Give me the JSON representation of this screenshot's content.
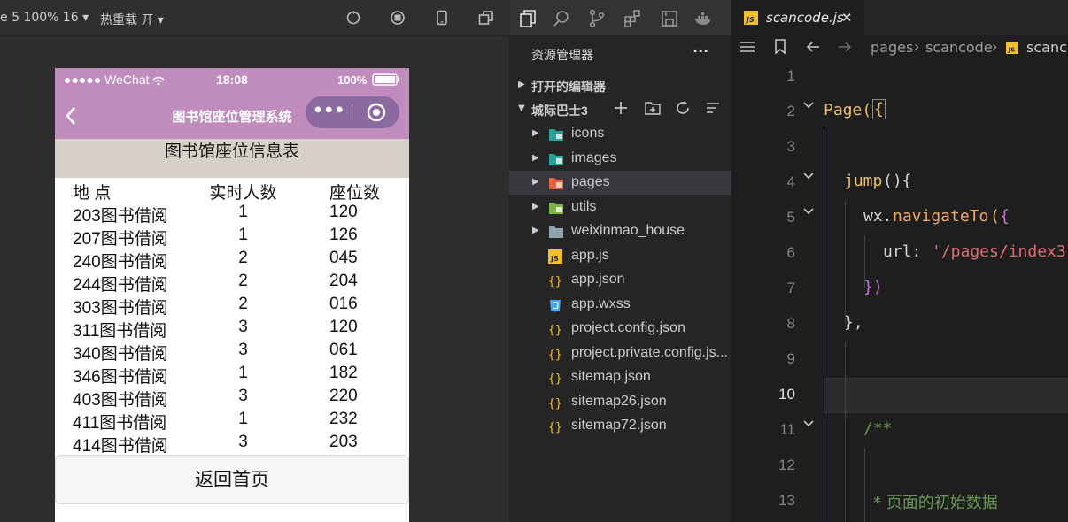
{
  "simulator": {
    "toolbar": {
      "device_label": "e 5 100% 16 ▾",
      "hot_reload_label": "热重载 开 ▾"
    },
    "phone": {
      "status": {
        "carrier": "●●●●● WeChat",
        "time": "18:08",
        "battery": "100%"
      },
      "nav_title": "图书馆座位管理系统",
      "capsule_more": "•••",
      "table_title": "图书馆座位信息表",
      "headers": [
        "地 点",
        "实时人数",
        "座位数"
      ],
      "rows": [
        [
          "203图书借阅",
          "1",
          "120"
        ],
        [
          "207图书借阅",
          "1",
          "126"
        ],
        [
          "240图书借阅",
          "2",
          "045"
        ],
        [
          "244图书借阅",
          "2",
          "204"
        ],
        [
          "303图书借阅",
          "2",
          "016"
        ],
        [
          "311图书借阅",
          "3",
          "120"
        ],
        [
          "340图书借阅",
          "3",
          "061"
        ],
        [
          "346图书借阅",
          "1",
          "182"
        ],
        [
          "403图书借阅",
          "3",
          "220"
        ],
        [
          "411图书借阅",
          "1",
          "232"
        ],
        [
          "414图书借阅",
          "3",
          "203"
        ]
      ],
      "home_button": "返回首页"
    }
  },
  "explorer": {
    "title": "资源管理器",
    "more": "···",
    "open_editors": "打开的编辑器",
    "project": "城际巴士3",
    "items": [
      {
        "label": "icons",
        "type": "folder",
        "icon": "folder-icons-icon"
      },
      {
        "label": "images",
        "type": "folder",
        "icon": "folder-images-icon"
      },
      {
        "label": "pages",
        "type": "folder",
        "icon": "folder-pages-icon",
        "selected": true
      },
      {
        "label": "utils",
        "type": "folder",
        "icon": "folder-utils-icon"
      },
      {
        "label": "weixinmao_house",
        "type": "folder",
        "icon": "folder-icon"
      },
      {
        "label": "app.js",
        "type": "file",
        "icon": "js-file-icon"
      },
      {
        "label": "app.json",
        "type": "file",
        "icon": "json-file-icon"
      },
      {
        "label": "app.wxss",
        "type": "file",
        "icon": "css-file-icon"
      },
      {
        "label": "project.config.json",
        "type": "file",
        "icon": "json-file-icon"
      },
      {
        "label": "project.private.config.js...",
        "type": "file",
        "icon": "json-file-icon"
      },
      {
        "label": "sitemap.json",
        "type": "file",
        "icon": "json-file-icon"
      },
      {
        "label": "sitemap26.json",
        "type": "file",
        "icon": "json-file-icon"
      },
      {
        "label": "sitemap72.json",
        "type": "file",
        "icon": "json-file-icon"
      }
    ]
  },
  "editor": {
    "tab": {
      "label": "scancode.js",
      "close": "✕"
    },
    "breadcrumb": {
      "seg1": "pages",
      "seg2": "scancode",
      "seg3": "scancc"
    },
    "line_numbers": [
      "1",
      "2",
      "3",
      "4",
      "5",
      "6",
      "7",
      "8",
      "9",
      "10",
      "11",
      "12",
      "13"
    ],
    "code": {
      "l2_a": "Page(",
      "l2_b": "{",
      "l4_a": "jump",
      "l4_b": "(){",
      "l5_a": "wx.",
      "l5_b": "navigateTo",
      "l5_c": "(",
      "l5_d": "{",
      "l6_a": "url: ",
      "l6_b": "'/pages/index3",
      "l7": "})",
      "l8": "},",
      "l11": "/**",
      "l13": "* 页面的初始数据"
    },
    "colors": {
      "keyword": "#dcdcaa",
      "func": "#f0a860",
      "string": "#e06c75",
      "comment": "#6a9955",
      "text": "#d4d4d4",
      "accent": "#e8bf6a"
    }
  }
}
